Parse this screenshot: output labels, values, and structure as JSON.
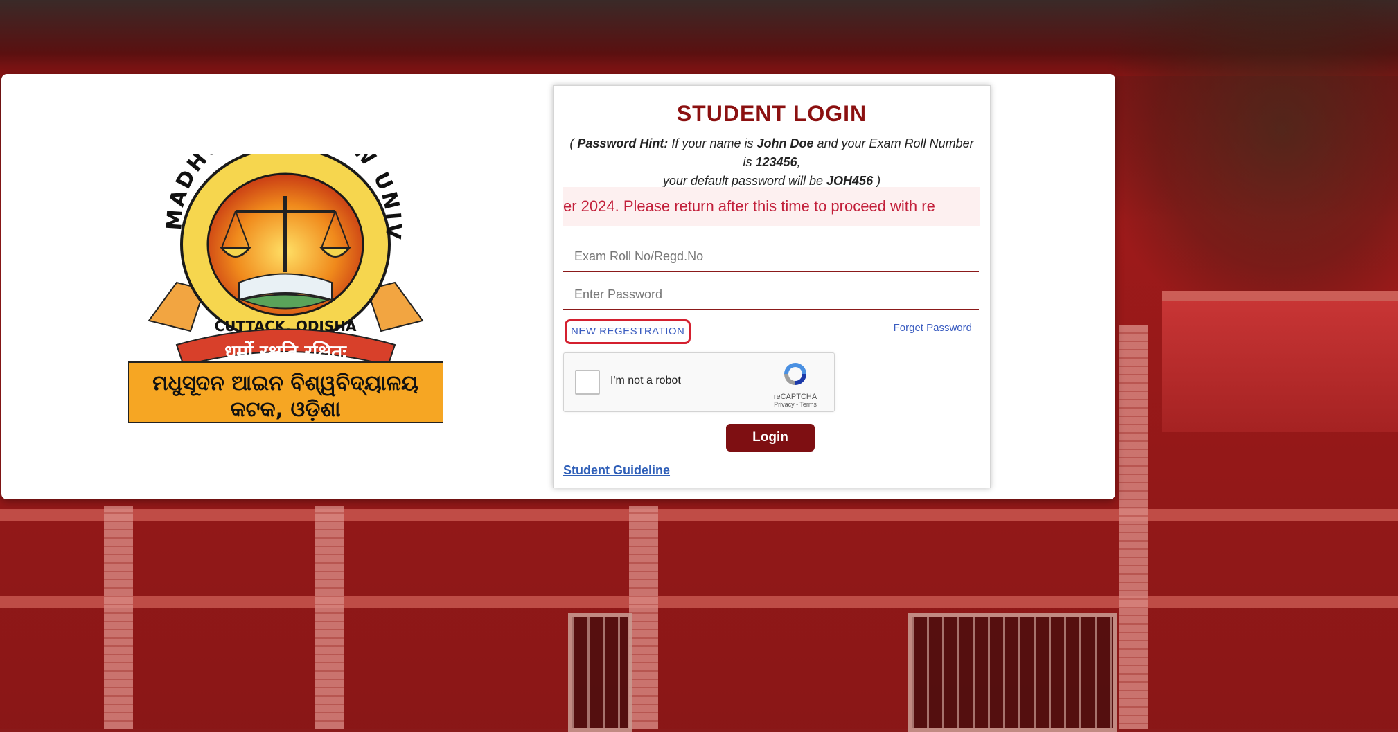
{
  "logo": {
    "ring_text": "MADHUSUDAN LAW UNIVERSITY",
    "city_text": "CUTTACK, ODISHA",
    "motto": "धर्मो रक्षति रक्षितः",
    "odia_line1": "ମଧୁସୂଦନ ଆଇନ ବିଶ୍ୱବିଦ୍ୟାଳୟ",
    "odia_line2": "କଟକ, ଓଡ଼ିଶା"
  },
  "login": {
    "title": "STUDENT LOGIN",
    "hint_prefix": "( ",
    "hint_label": "Password Hint:",
    "hint_text1": " If your name is ",
    "hint_name": "John Doe",
    "hint_text2": " and your Exam Roll Number is ",
    "hint_roll": "123456",
    "hint_text3": ",",
    "hint_text4": "your default password will be ",
    "hint_pass": "JOH456",
    "hint_suffix": " )",
    "marquee": "er 2024. Please return after this time to proceed with re",
    "roll_placeholder": "Exam Roll No/Regd.No",
    "password_placeholder": "Enter Password",
    "new_registration": "NEW REGESTRATION",
    "forget_password": "Forget Password",
    "captcha_label": "I'm not a robot",
    "captcha_brand": "reCAPTCHA",
    "captcha_terms": "Privacy - Terms",
    "login_button": "Login",
    "guideline_link": "Student Guideline"
  },
  "colors": {
    "title": "#8b1010",
    "button": "#7e0f12",
    "link": "#3a5cc0",
    "marquee_text": "#c21f3a"
  }
}
